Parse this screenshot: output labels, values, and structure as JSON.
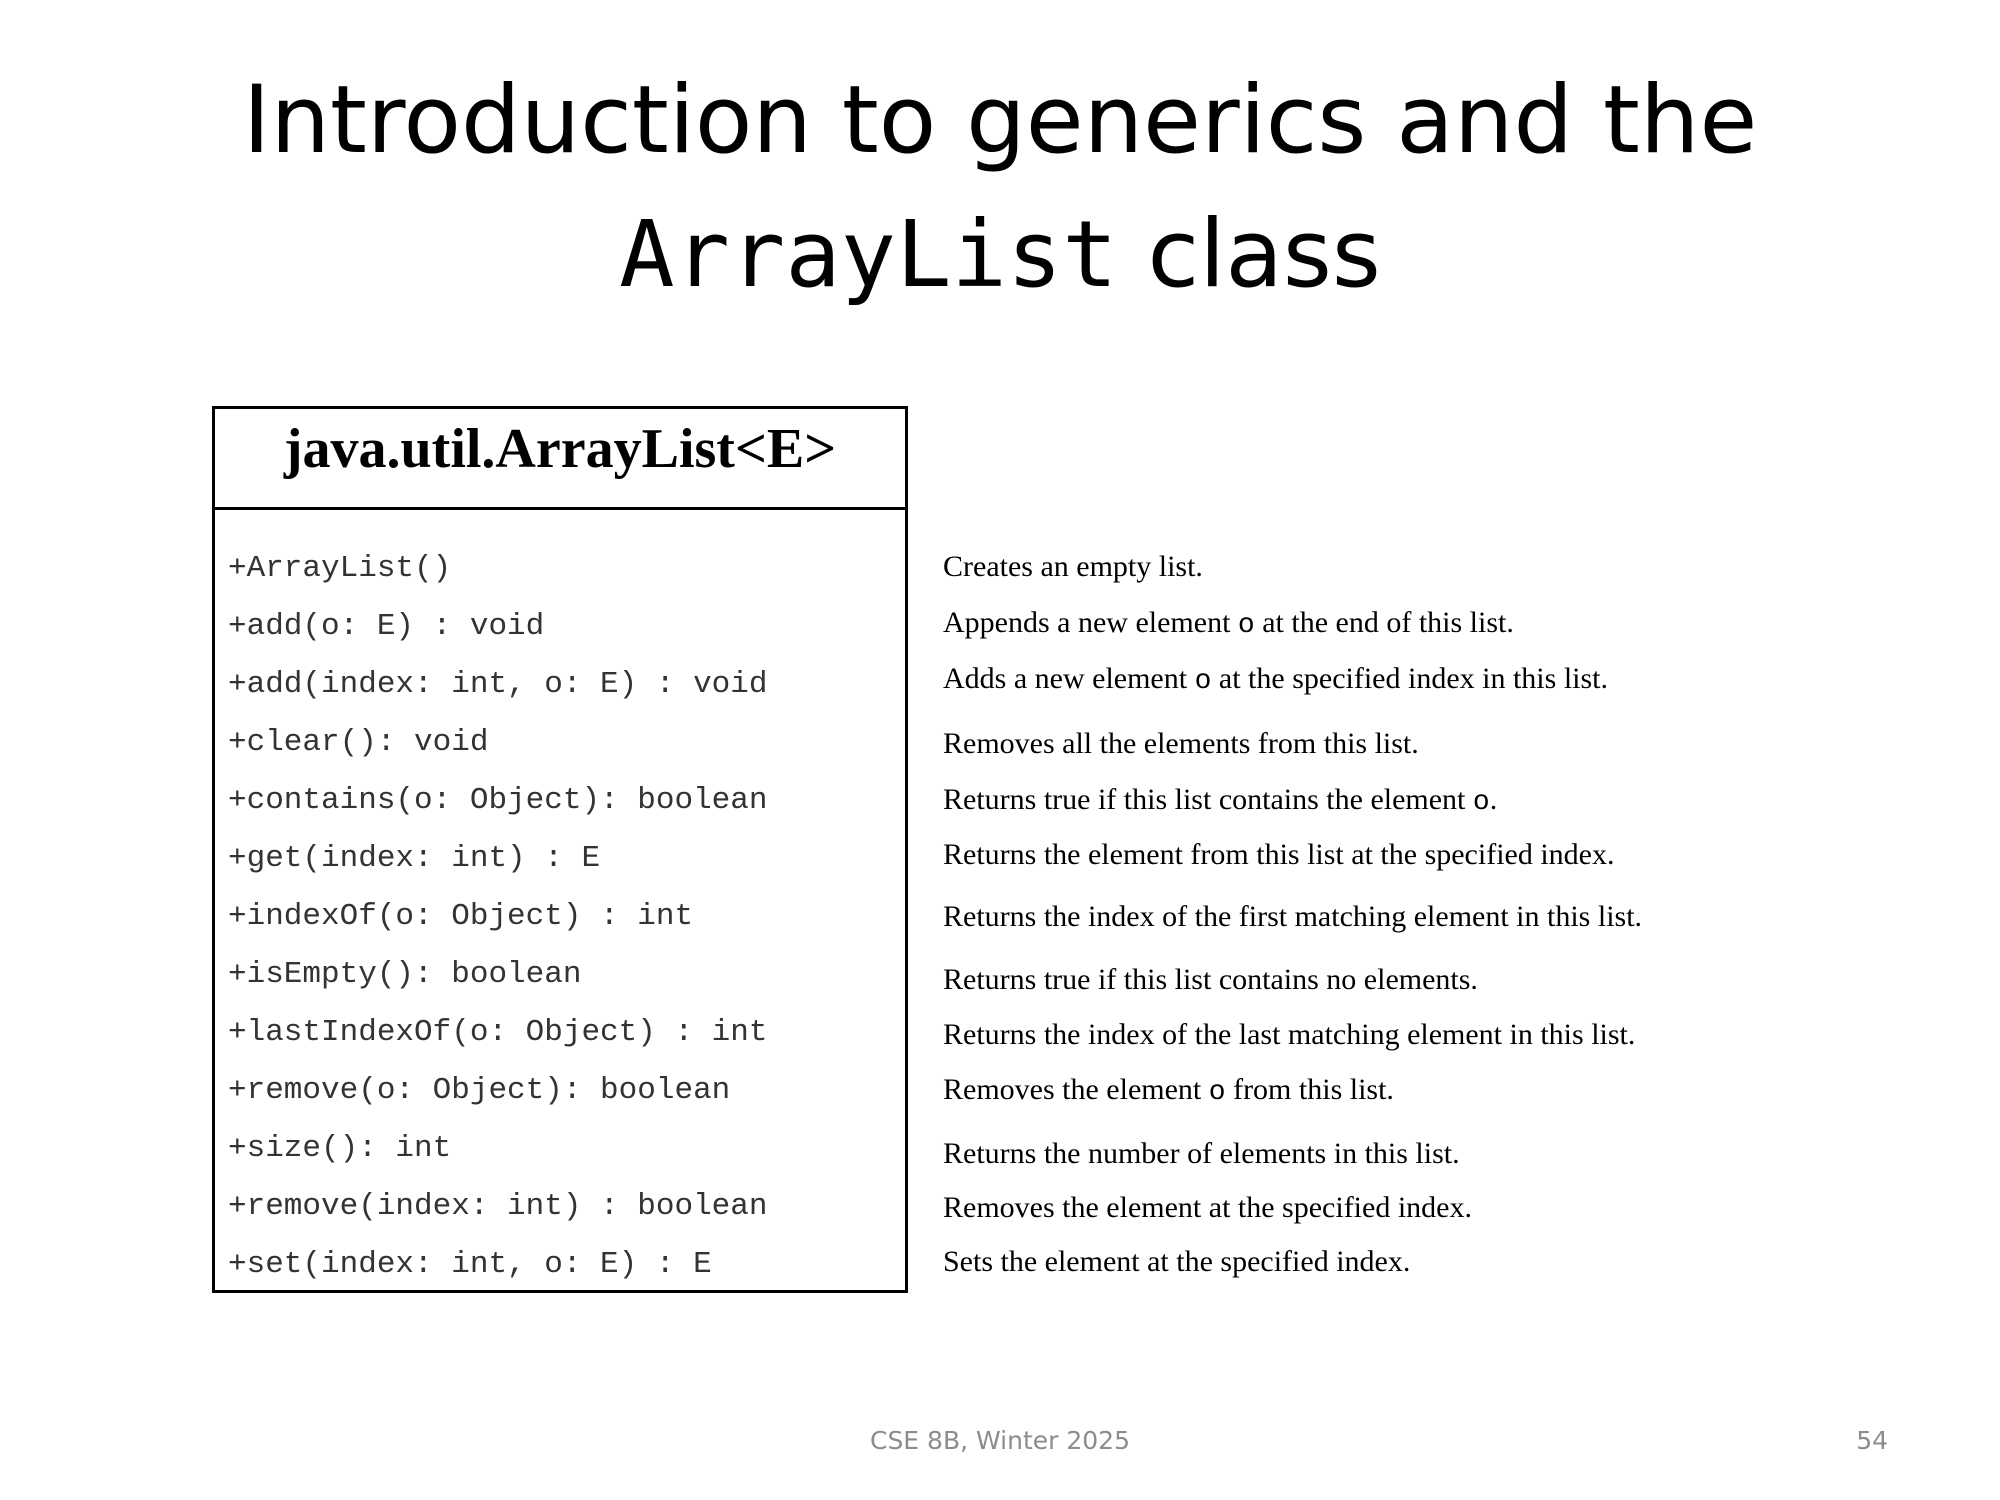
{
  "title": {
    "line1": "Introduction to generics and the",
    "code": "ArrayList",
    "suffix": "class"
  },
  "uml": {
    "class_name": "java.util.ArrayList<E>",
    "members": [
      {
        "signature": "+ArrayList()",
        "desc": [
          "Creates an empty list."
        ]
      },
      {
        "signature": "+add(o: E) : void",
        "desc": [
          "Appends a new element ",
          "o",
          " at the end of this list."
        ]
      },
      {
        "signature": "+add(index: int, o: E) : void",
        "desc": [
          "Adds a new element ",
          "o",
          " at the specified index in this list."
        ]
      },
      {
        "signature": "+clear(): void",
        "desc": [
          "Removes all the elements from this list."
        ]
      },
      {
        "signature": "+contains(o: Object): boolean",
        "desc": [
          "Returns true if this list contains the element ",
          "o",
          "."
        ]
      },
      {
        "signature": "+get(index: int) : E",
        "desc": [
          "Returns the element from this list at the specified index."
        ]
      },
      {
        "signature": "+indexOf(o: Object) : int",
        "desc": [
          "Returns the index of the first matching element in this list."
        ]
      },
      {
        "signature": "+isEmpty(): boolean",
        "desc": [
          "Returns true if this list contains no elements."
        ]
      },
      {
        "signature": "+lastIndexOf(o: Object) : int",
        "desc": [
          "Returns the index of the last matching element in this list."
        ]
      },
      {
        "signature": "+remove(o: Object): boolean",
        "desc": [
          "Removes the element ",
          "o",
          " from this list."
        ]
      },
      {
        "signature": "+size(): int",
        "desc": [
          "Returns the number of elements in this list."
        ]
      },
      {
        "signature": "+remove(index: int) : boolean",
        "desc": [
          "Removes the element at the specified index."
        ]
      },
      {
        "signature": "+set(index: int, o: E) : E",
        "desc": [
          "Sets the element at the specified index."
        ]
      }
    ]
  },
  "footer": {
    "course": "CSE 8B, Winter 2025",
    "page": "54"
  }
}
